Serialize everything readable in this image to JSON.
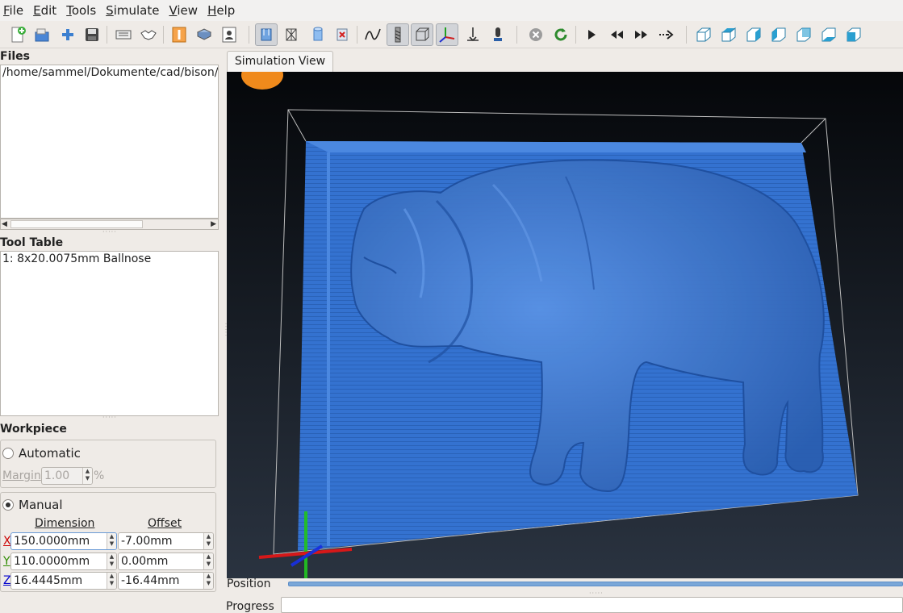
{
  "menubar": {
    "items": [
      {
        "label": "File",
        "mnemonic": "F",
        "rest": "ile"
      },
      {
        "label": "Edit",
        "mnemonic": "E",
        "rest": "dit"
      },
      {
        "label": "Tools",
        "mnemonic": "T",
        "rest": "ools"
      },
      {
        "label": "Simulate",
        "mnemonic": "S",
        "rest": "imulate"
      },
      {
        "label": "View",
        "mnemonic": "V",
        "rest": "iew"
      },
      {
        "label": "Help",
        "mnemonic": "H",
        "rest": "elp"
      }
    ]
  },
  "toolbar": {
    "icons": [
      "new-file-icon",
      "open-icon",
      "add-icon",
      "save-icon",
      "gcode-icon",
      "handshake-icon",
      "tool-icon",
      "workpiece-icon",
      "user-icon",
      "show-stock-icon",
      "show-mesh-icon",
      "show-cylinder-icon",
      "remove-icon",
      "toolpath-icon",
      "show-tool-icon",
      "bounding-box-icon",
      "axes-icon",
      "lamp-icon",
      "probe-icon",
      "stop-icon",
      "refresh-icon",
      "play-icon",
      "rewind-icon",
      "fast-forward-icon",
      "step-icon",
      "view-front-icon",
      "view-top-icon",
      "view-right-icon",
      "view-left-icon",
      "view-back-icon",
      "view-bottom-icon",
      "view-iso-icon"
    ]
  },
  "files": {
    "title": "Files",
    "entries": [
      "/home/sammel/Dokumente/cad/bison/b"
    ]
  },
  "tool_table": {
    "title": "Tool Table",
    "entries": [
      "1: 8x20.0075mm Ballnose"
    ]
  },
  "workpiece": {
    "title": "Workpiece",
    "automatic_label": "Automatic",
    "margin_label": "Margin",
    "margin_value": "1.00",
    "margin_unit": "%",
    "manual_label": "Manual",
    "dimension_header": "Dimension",
    "offset_header": "Offset",
    "rows": [
      {
        "axis": "X",
        "dimension": "150.0000mm",
        "offset": "-7.00mm",
        "color": "#cc0000"
      },
      {
        "axis": "Y",
        "dimension": "110.0000mm",
        "offset": "0.00mm",
        "color": "#2e8b00"
      },
      {
        "axis": "Z",
        "dimension": "16.4445mm",
        "offset": "-16.44mm",
        "color": "#0000cc"
      }
    ]
  },
  "simulation": {
    "tab_label": "Simulation View",
    "stock_color": "#2f6fd0",
    "background_color": "#000000"
  },
  "status": {
    "position_label": "Position",
    "progress_label": "Progress"
  }
}
